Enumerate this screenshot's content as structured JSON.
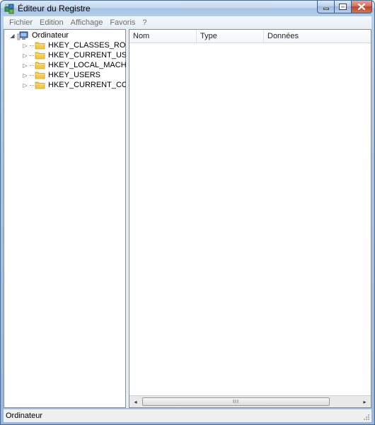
{
  "window": {
    "title": "Éditeur du Registre"
  },
  "menu": [
    "Fichier",
    "Edition",
    "Affichage",
    "Favoris",
    "?"
  ],
  "tree": {
    "root_label": "Ordinateur",
    "root_expander": "◢",
    "children": [
      {
        "label": "HKEY_CLASSES_ROOT",
        "expander": "▷"
      },
      {
        "label": "HKEY_CURRENT_USER",
        "expander": "▷"
      },
      {
        "label": "HKEY_LOCAL_MACHINE",
        "expander": "▷"
      },
      {
        "label": "HKEY_USERS",
        "expander": "▷"
      },
      {
        "label": "HKEY_CURRENT_CONFIG",
        "expander": "▷"
      }
    ]
  },
  "list": {
    "columns": [
      "Nom",
      "Type",
      "Données"
    ],
    "scroll_left": "◂",
    "scroll_right": "▸",
    "scroll_grip": "III"
  },
  "status": {
    "text": "Ordinateur"
  },
  "colors": {
    "title_gradient": "#b9d1ea",
    "close_button": "#c2412a",
    "folder": "#f2c94c"
  }
}
